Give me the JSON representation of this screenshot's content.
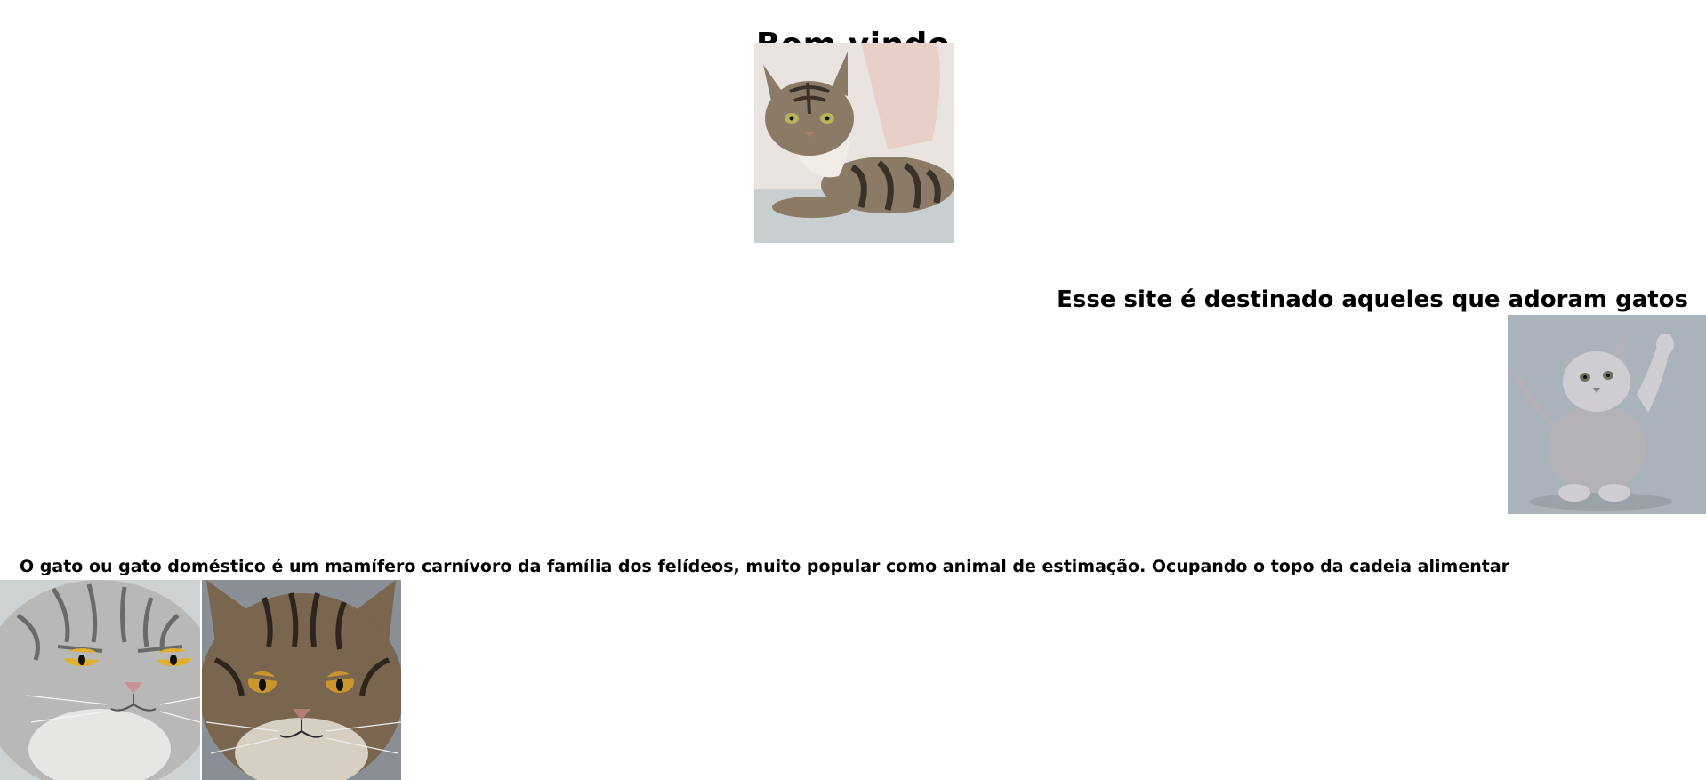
{
  "header": {
    "title": "Bem vindo"
  },
  "intro": {
    "subtitle": "Esse site é destinado aqueles que adoram gatos"
  },
  "content": {
    "paragraph": "O gato ou gato doméstico é um mamífero carnívoro da família dos felídeos, muito popular como animal de estimação. Ocupando o topo da cadeia alimentar"
  },
  "images": [
    {
      "name": "tabby-cat-lying-photo",
      "palette": {
        "bg": "#e9e4e0",
        "cushion": "#e8cfc7",
        "floor": "#c9cfd1",
        "fur": "#8a7a66",
        "stripe": "#3b3126",
        "chest": "#f1ede6",
        "eye": "#b7b35a"
      }
    },
    {
      "name": "grey-kitten-waving-photo",
      "palette": {
        "bg": "#aab3bb",
        "fur": "#b4b2b6",
        "fur_light": "#cfcdd1",
        "shadow": "#8b8f95",
        "eye": "#6f6f60"
      }
    },
    {
      "name": "grumpy-silver-cat-photo",
      "palette": {
        "bg": "#cfd2d3",
        "fur": "#b8b8b6",
        "stripe": "#6a6a68",
        "fur_light": "#e7e6e3",
        "eye": "#e0b02a",
        "nose": "#c9929a"
      }
    },
    {
      "name": "grumpy-tabby-cat-photo",
      "palette": {
        "bg": "#8a8f95",
        "fur": "#7a654f",
        "stripe": "#2e261e",
        "fur_light": "#d8cfc3",
        "eye": "#c8962c",
        "nose": "#b27e76"
      }
    }
  ]
}
